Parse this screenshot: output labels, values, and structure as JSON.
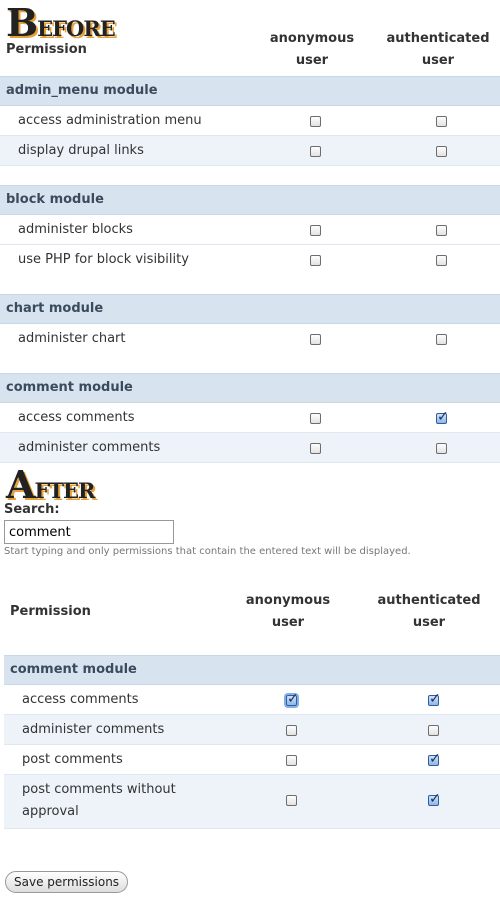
{
  "before": {
    "title_cap": "B",
    "title_rest": "efore",
    "col_permission": "Permission",
    "col_anonymous_line1": "anonymous",
    "col_anonymous_line2": "user",
    "col_authenticated_line1": "authenticated",
    "col_authenticated_line2": "user",
    "modules": [
      {
        "name": "admin_menu module",
        "perms": [
          {
            "label": "access administration menu",
            "anon": false,
            "auth": false
          },
          {
            "label": "display drupal links",
            "anon": false,
            "auth": false
          }
        ]
      },
      {
        "name": "block module",
        "perms": [
          {
            "label": "administer blocks",
            "anon": false,
            "auth": false
          },
          {
            "label": "use PHP for block visibility",
            "anon": false,
            "auth": false
          }
        ]
      },
      {
        "name": "chart module",
        "perms": [
          {
            "label": "administer chart",
            "anon": false,
            "auth": false
          }
        ]
      },
      {
        "name": "comment module",
        "perms": [
          {
            "label": "access comments",
            "anon": false,
            "auth": true
          },
          {
            "label": "administer comments",
            "anon": false,
            "auth": false
          }
        ]
      }
    ]
  },
  "after": {
    "title_cap": "A",
    "title_rest": "fter",
    "search_label": "Search:",
    "search_value": "comment",
    "search_hint": "Start typing and only permissions that contain the entered text will be displayed.",
    "col_permission": "Permission",
    "col_anonymous_line1": "anonymous",
    "col_anonymous_line2": "user",
    "col_authenticated_line1": "authenticated",
    "col_authenticated_line2": "user",
    "module_name": "comment module",
    "perms": [
      {
        "label": "access comments",
        "anon": true,
        "auth": true
      },
      {
        "label": "administer comments",
        "anon": false,
        "auth": false
      },
      {
        "label": "post comments",
        "anon": false,
        "auth": true
      },
      {
        "label_line1": "post comments without",
        "label_line2": "approval",
        "anon": false,
        "auth": true
      }
    ],
    "save_label": "Save permissions"
  }
}
